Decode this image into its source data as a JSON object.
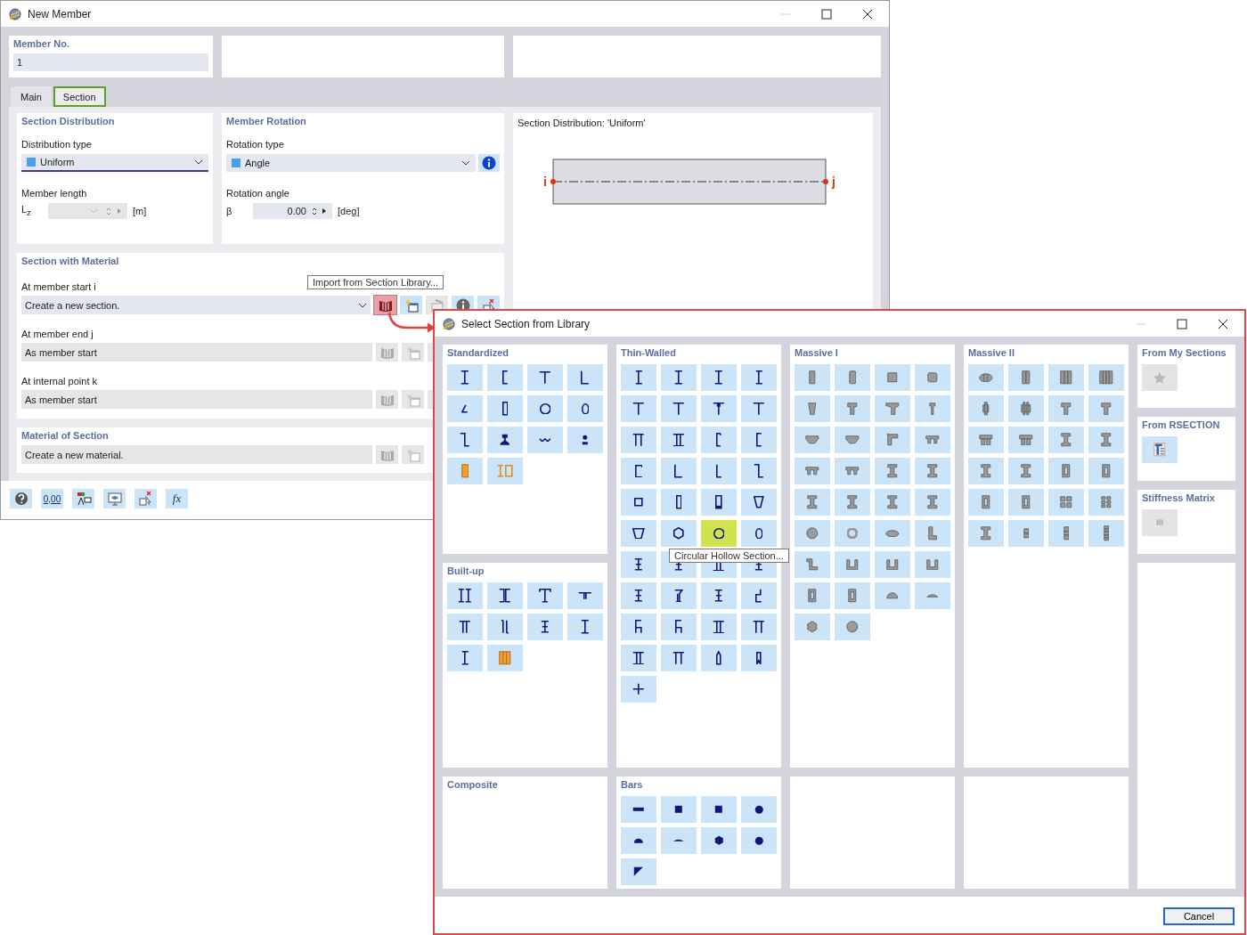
{
  "member_window": {
    "title": "New Member",
    "member_no": {
      "label": "Member No.",
      "value": "1"
    },
    "tabs": [
      {
        "label": "Main",
        "selected": false
      },
      {
        "label": "Section",
        "selected": true
      }
    ],
    "section_distribution": {
      "title": "Section Distribution",
      "type_label": "Distribution type",
      "type_value": "Uniform",
      "length_label": "Member length",
      "length_symbol": "L$_{z}$",
      "length_unit": "[m]"
    },
    "member_rotation": {
      "title": "Member Rotation",
      "type_label": "Rotation type",
      "type_value": "Angle",
      "angle_label": "Rotation angle",
      "angle_symbol": "β",
      "angle_value": "0.00",
      "angle_unit": "[deg]"
    },
    "section_with_material": {
      "title": "Section with Material",
      "rows": [
        {
          "label": "At member start i",
          "value": "Create a new section.",
          "disabled": false,
          "highlighted": true
        },
        {
          "label": "At member end j",
          "value": "As member start",
          "disabled": true,
          "highlighted": false
        },
        {
          "label": "At internal point k",
          "value": "As member start",
          "disabled": true,
          "highlighted": false
        }
      ]
    },
    "material_of_section": {
      "title": "Material of Section",
      "value": "Create a new material."
    },
    "preview": {
      "title": "Section Distribution: 'Uniform'",
      "start_label": "i",
      "end_label": "j"
    },
    "tooltip": "Import from Section Library...",
    "toolbar": [
      {
        "kind": "help"
      },
      {
        "kind": "values",
        "text": "0,00"
      },
      {
        "kind": "display"
      },
      {
        "kind": "view"
      },
      {
        "kind": "delete"
      },
      {
        "kind": "formula",
        "text": "fx"
      }
    ]
  },
  "library_window": {
    "title": "Select Section from Library",
    "tooltip": "Circular Hollow Section...",
    "groups": [
      {
        "title": "Standardized",
        "tiles": [
          {
            "selected": false
          },
          {
            "selected": false
          },
          {
            "selected": false
          },
          {
            "selected": false
          },
          {
            "selected": false
          },
          {
            "selected": false
          },
          {
            "selected": false
          },
          {
            "selected": false
          },
          {
            "selected": false
          },
          {
            "selected": false
          },
          {
            "selected": false
          },
          {
            "selected": false
          },
          {
            "selected": false
          },
          {
            "selected": false
          }
        ]
      },
      {
        "title": "Thin-Walled",
        "tiles": [
          {
            "selected": false
          },
          {
            "selected": false
          },
          {
            "selected": false
          },
          {
            "selected": false
          },
          {
            "selected": false
          },
          {
            "selected": false
          },
          {
            "selected": false
          },
          {
            "selected": false
          },
          {
            "selected": false
          },
          {
            "selected": false
          },
          {
            "selected": false
          },
          {
            "selected": false
          },
          {
            "selected": false
          },
          {
            "selected": false
          },
          {
            "selected": false
          },
          {
            "selected": false
          },
          {
            "selected": false
          },
          {
            "selected": false
          },
          {
            "selected": false
          },
          {
            "selected": false
          },
          {
            "selected": false
          },
          {
            "selected": false
          },
          {
            "selected": true
          },
          {
            "selected": false
          },
          {
            "selected": false
          },
          {
            "selected": false
          },
          {
            "selected": false
          },
          {
            "selected": false
          },
          {
            "selected": false
          },
          {
            "selected": false
          },
          {
            "selected": false
          },
          {
            "selected": false
          },
          {
            "selected": false
          },
          {
            "selected": false
          },
          {
            "selected": false
          },
          {
            "selected": false
          },
          {
            "selected": false
          },
          {
            "selected": false
          },
          {
            "selected": false
          },
          {
            "selected": false
          },
          {
            "selected": false
          }
        ]
      },
      {
        "title": "Massive I",
        "tiles": [
          {
            "selected": false
          },
          {
            "selected": false
          },
          {
            "selected": false
          },
          {
            "selected": false
          },
          {
            "selected": false
          },
          {
            "selected": false
          },
          {
            "selected": false
          },
          {
            "selected": false
          },
          {
            "selected": false
          },
          {
            "selected": false
          },
          {
            "selected": false
          },
          {
            "selected": false
          },
          {
            "selected": false
          },
          {
            "selected": false
          },
          {
            "selected": false
          },
          {
            "selected": false
          },
          {
            "selected": false
          },
          {
            "selected": false
          },
          {
            "selected": false
          },
          {
            "selected": false
          },
          {
            "selected": false
          },
          {
            "selected": false
          },
          {
            "selected": false
          },
          {
            "selected": false
          },
          {
            "selected": false
          },
          {
            "selected": false
          },
          {
            "selected": false
          },
          {
            "selected": false
          },
          {
            "selected": false
          },
          {
            "selected": false
          },
          {
            "selected": false
          },
          {
            "selected": false
          },
          {
            "selected": false
          },
          {
            "selected": false
          }
        ]
      },
      {
        "title": "Massive II",
        "tiles": [
          {
            "selected": false
          },
          {
            "selected": false
          },
          {
            "selected": false
          },
          {
            "selected": false
          },
          {
            "selected": false
          },
          {
            "selected": false
          },
          {
            "selected": false
          },
          {
            "selected": false
          },
          {
            "selected": false
          },
          {
            "selected": false
          },
          {
            "selected": false
          },
          {
            "selected": false
          },
          {
            "selected": false
          },
          {
            "selected": false
          },
          {
            "selected": false
          },
          {
            "selected": false
          },
          {
            "selected": false
          },
          {
            "selected": false
          },
          {
            "selected": false
          },
          {
            "selected": false
          },
          {
            "selected": false
          },
          {
            "selected": false
          },
          {
            "selected": false
          },
          {
            "selected": false
          }
        ]
      },
      {
        "title": "From My Sections",
        "tiles": [
          {
            "selected": false,
            "disabled": true
          }
        ]
      },
      {
        "title": "From RSECTION",
        "tiles": [
          {
            "selected": false,
            "disabled": false
          }
        ]
      },
      {
        "title": "Stiffness Matrix",
        "tiles": [
          {
            "selected": false,
            "disabled": true
          }
        ]
      },
      {
        "title": "Built-up",
        "tiles": [
          {
            "selected": false
          },
          {
            "selected": false
          },
          {
            "selected": false
          },
          {
            "selected": false
          },
          {
            "selected": false
          },
          {
            "selected": false
          },
          {
            "selected": false
          },
          {
            "selected": false
          },
          {
            "selected": false
          },
          {
            "selected": false
          }
        ]
      },
      {
        "title": "Composite"
      },
      {
        "title": "Bars",
        "tiles": [
          {
            "selected": false
          },
          {
            "selected": false
          },
          {
            "selected": false
          },
          {
            "selected": false
          },
          {
            "selected": false
          },
          {
            "selected": false
          },
          {
            "selected": false
          },
          {
            "selected": false
          },
          {
            "selected": false
          }
        ]
      }
    ],
    "buttons": [
      {
        "label": "Cancel"
      }
    ]
  }
}
